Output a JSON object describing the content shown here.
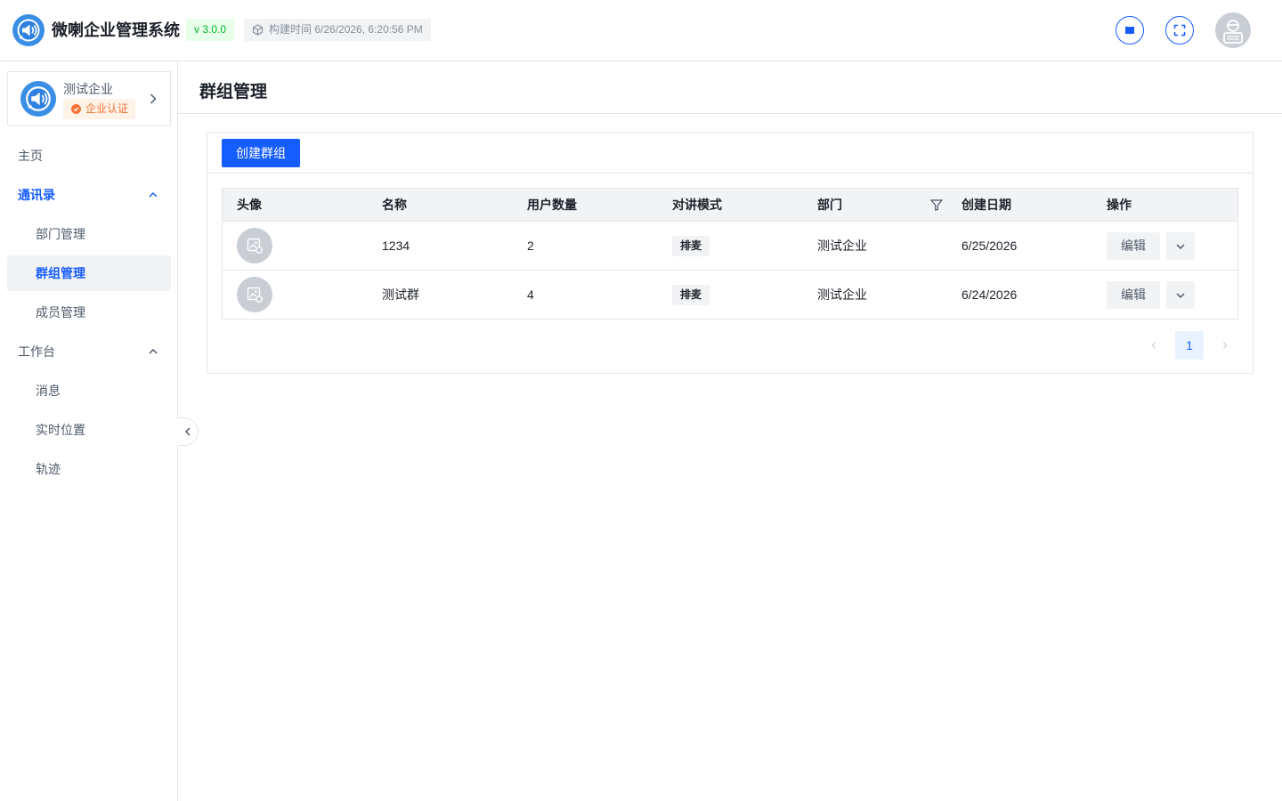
{
  "header": {
    "app_title": "微喇企业管理系统",
    "version": "v 3.0.0",
    "build_time": "构建时间 6/26/2026, 6:20:56 PM",
    "icons": [
      "logo-icon",
      "cube-icon",
      "book-icon",
      "fullscreen-icon",
      "user-avatar"
    ]
  },
  "sidebar": {
    "company": {
      "name": "测试企业",
      "badge": "企业认证"
    },
    "menu": {
      "home": "主页",
      "contacts": "通讯录",
      "department": "部门管理",
      "groups": "群组管理",
      "members": "成员管理",
      "workbench": "工作台",
      "messages": "消息",
      "realtime_location": "实时位置",
      "track": "轨迹"
    },
    "selected": "群组管理"
  },
  "main": {
    "page_title": "群组管理",
    "create_button": "创建群组",
    "table": {
      "columns": [
        "头像",
        "名称",
        "用户数量",
        "对讲模式",
        "部门",
        "创建日期",
        "操作"
      ],
      "rows": [
        {
          "name": "1234",
          "user_count": "2",
          "mode": "排麦",
          "department": "测试企业",
          "created": "6/25/2026",
          "edit": "编辑"
        },
        {
          "name": "测试群",
          "user_count": "4",
          "mode": "排麦",
          "department": "测试企业",
          "created": "6/24/2026",
          "edit": "编辑"
        }
      ]
    },
    "pagination": {
      "current_page": "1"
    }
  },
  "colors": {
    "primary": "#165dff",
    "version_green": "#00b42a",
    "badge_orange": "#f77234",
    "border": "#e5e6eb"
  }
}
